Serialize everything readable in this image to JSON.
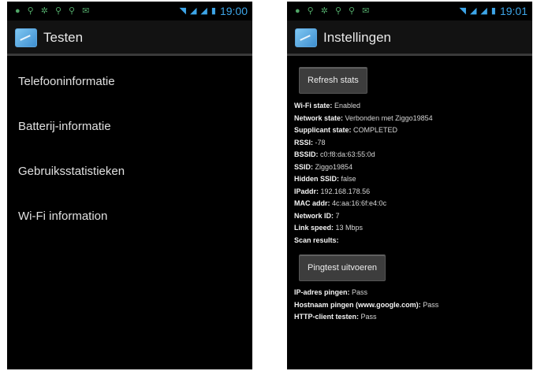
{
  "left_screen": {
    "status_time": "19:00",
    "title": "Testen",
    "items": [
      "Telefooninformatie",
      "Batterij-informatie",
      "Gebruiksstatistieken",
      "Wi-Fi information"
    ]
  },
  "right_screen": {
    "status_time": "19:01",
    "title": "Instellingen",
    "refresh_button": "Refresh stats",
    "stats": [
      {
        "label": "Wi-Fi state:",
        "value": "Enabled"
      },
      {
        "label": "Network state:",
        "value": "Verbonden met Ziggo19854"
      },
      {
        "label": "Supplicant state:",
        "value": "COMPLETED"
      },
      {
        "label": "RSSI:",
        "value": "-78"
      },
      {
        "label": "BSSID:",
        "value": "c0:f8:da:63:55:0d"
      },
      {
        "label": "SSID:",
        "value": "Ziggo19854"
      },
      {
        "label": "Hidden SSID:",
        "value": "false"
      },
      {
        "label": "IPaddr:",
        "value": "192.168.178.56"
      },
      {
        "label": "MAC addr:",
        "value": "4c:aa:16:6f:e4:0c"
      },
      {
        "label": "Network ID:",
        "value": "7"
      },
      {
        "label": "Link speed:",
        "value": "13 Mbps"
      },
      {
        "label": "Scan results:",
        "value": ""
      }
    ],
    "ping_button": "Pingtest uitvoeren",
    "ping_results": [
      {
        "label": "IP-adres pingen:",
        "value": "Pass"
      },
      {
        "label": "Hostnaam pingen (www.google.com):",
        "value": "Pass"
      },
      {
        "label": "HTTP-client testen:",
        "value": "Pass"
      }
    ]
  },
  "colors": {
    "status_blue": "#3da5e8",
    "notif_green": "#5fc47a",
    "background": "#000000"
  }
}
